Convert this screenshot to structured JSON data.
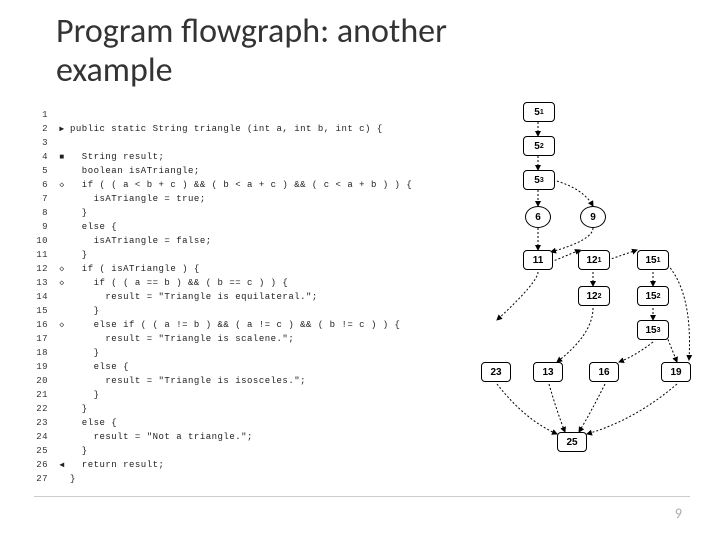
{
  "title_line1": "Program flowgraph: another",
  "title_line2": "example",
  "page_number": "9",
  "code": [
    {
      "n": "1",
      "g": "",
      "t": ""
    },
    {
      "n": "2",
      "g": "▶",
      "t": "public static String triangle (int a, int b, int c) {"
    },
    {
      "n": "3",
      "g": "",
      "t": ""
    },
    {
      "n": "4",
      "g": "■",
      "t": "  String result;"
    },
    {
      "n": "5",
      "g": "",
      "t": "  boolean isATriangle;"
    },
    {
      "n": "6",
      "g": "◇",
      "t": "  if ( ( a < b + c ) && ( b < a + c ) && ( c < a + b ) ) {"
    },
    {
      "n": "7",
      "g": "",
      "t": "    isATriangle = true;"
    },
    {
      "n": "8",
      "g": "",
      "t": "  }"
    },
    {
      "n": "9",
      "g": "",
      "t": "  else {"
    },
    {
      "n": "10",
      "g": "",
      "t": "    isATriangle = false;"
    },
    {
      "n": "11",
      "g": "",
      "t": "  }"
    },
    {
      "n": "12",
      "g": "◇",
      "t": "  if ( isATriangle ) {"
    },
    {
      "n": "13",
      "g": "◇",
      "t": "    if ( ( a == b ) && ( b == c ) ) {"
    },
    {
      "n": "14",
      "g": "",
      "t": "      result = \"Triangle is equilateral.\";"
    },
    {
      "n": "15",
      "g": "",
      "t": "    }"
    },
    {
      "n": "16",
      "g": "◇",
      "t": "    else if ( ( a != b ) && ( a != c ) && ( b != c ) ) {"
    },
    {
      "n": "17",
      "g": "",
      "t": "      result = \"Triangle is scalene.\";"
    },
    {
      "n": "18",
      "g": "",
      "t": "    }"
    },
    {
      "n": "19",
      "g": "",
      "t": "    else {"
    },
    {
      "n": "20",
      "g": "",
      "t": "      result = \"Triangle is isosceles.\";"
    },
    {
      "n": "21",
      "g": "",
      "t": "    }"
    },
    {
      "n": "22",
      "g": "",
      "t": "  }"
    },
    {
      "n": "23",
      "g": "",
      "t": "  else {"
    },
    {
      "n": "24",
      "g": "",
      "t": "    result = \"Not a triangle.\";"
    },
    {
      "n": "25",
      "g": "",
      "t": "  }"
    },
    {
      "n": "26",
      "g": "◀",
      "t": "  return result;"
    },
    {
      "n": "27",
      "g": "",
      "t": "}"
    }
  ],
  "nodes": {
    "n5_1": "5",
    "s5_1": "1",
    "n5_2": "5",
    "s5_2": "2",
    "n5_3": "5",
    "s5_3": "3",
    "n6": "6",
    "n9": "9",
    "n11": "11",
    "n12_1": "12",
    "s12_1": "1",
    "n12_2": "12",
    "s12_2": "2",
    "n15_1": "15",
    "s15_1": "1",
    "n15_2": "15",
    "s15_2": "2",
    "n15_3": "15",
    "s15_3": "3",
    "n23": "23",
    "n13": "13",
    "n16": "16",
    "n19": "19",
    "n25": "25"
  }
}
